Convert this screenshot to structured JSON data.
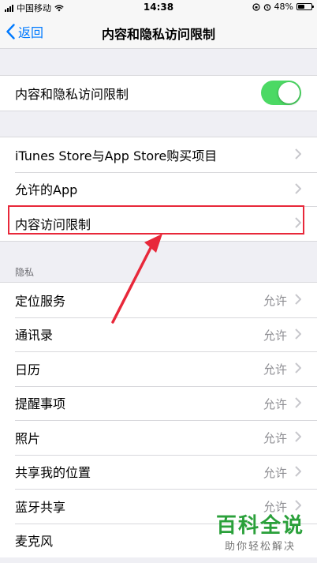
{
  "status_bar": {
    "carrier": "中国移动",
    "time": "14:38",
    "battery": "48%",
    "battery_level": 0.48
  },
  "nav": {
    "back_label": "返回",
    "title": "内容和隐私访问限制"
  },
  "toggle_row": {
    "label": "内容和隐私访问限制",
    "enabled": true
  },
  "store_group": [
    {
      "label": "iTunes Store与App Store购买项目"
    },
    {
      "label": "允许的App"
    },
    {
      "label": "内容访问限制"
    }
  ],
  "privacy": {
    "header": "隐私",
    "items": [
      {
        "label": "定位服务",
        "value": "允许"
      },
      {
        "label": "通讯录",
        "value": "允许"
      },
      {
        "label": "日历",
        "value": "允许"
      },
      {
        "label": "提醒事项",
        "value": "允许"
      },
      {
        "label": "照片",
        "value": "允许"
      },
      {
        "label": "共享我的位置",
        "value": "允许"
      },
      {
        "label": "蓝牙共享",
        "value": "允许"
      },
      {
        "label": "麦克风",
        "value": ""
      }
    ]
  },
  "watermark": {
    "title": "百科全说",
    "subtitle": "助你轻松解决"
  },
  "colors": {
    "accent": "#007aff",
    "toggle_on": "#4cd964",
    "highlight_border": "#e8283a",
    "arrow": "#e8283a",
    "watermark": "#2aa03a"
  }
}
